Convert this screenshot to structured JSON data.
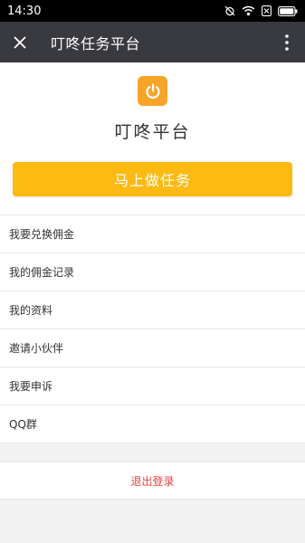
{
  "status_bar": {
    "time": "14:30"
  },
  "title_bar": {
    "title": "叮咚任务平台"
  },
  "header": {
    "app_name": "叮咚平台",
    "primary_button": "马上做任务"
  },
  "menu": {
    "items": [
      {
        "label": "我要兑换佣金"
      },
      {
        "label": "我的佣金记录"
      },
      {
        "label": "我的资料"
      },
      {
        "label": "邀请小伙伴"
      },
      {
        "label": "我要申诉"
      },
      {
        "label": "QQ群"
      }
    ]
  },
  "logout": {
    "label": "退出登录"
  },
  "colors": {
    "accent": "#fcba12",
    "logo": "#f6a42a",
    "danger": "#e64340",
    "titlebar": "#393a3f"
  }
}
